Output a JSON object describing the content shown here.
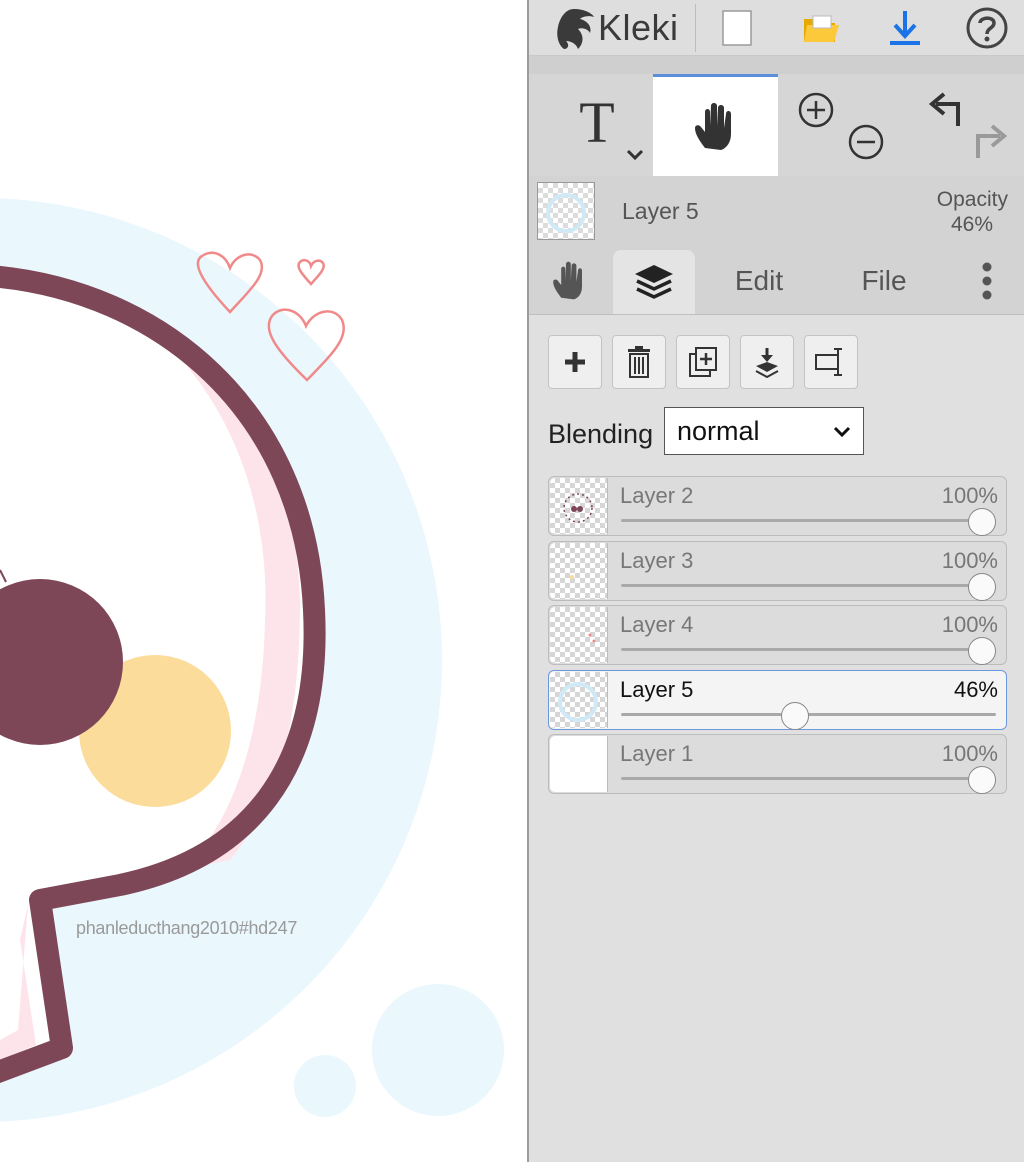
{
  "app": {
    "name": "Kleki"
  },
  "canvas": {
    "signature": "phanleducthang2010#hd247",
    "colors": {
      "outline": "#7d4757",
      "light_blue": "#eaf7fd",
      "pink_shadow": "#fde4ea",
      "dark_circle": "#7d4757",
      "yellow_circle": "#fcdc9a",
      "hearts": "#f08a8a"
    }
  },
  "toolbar": {
    "icons": [
      "kleki-logo-icon",
      "new-file-icon",
      "open-folder-icon",
      "download-icon",
      "help-icon"
    ]
  },
  "tools": {
    "text_glyph": "T",
    "active_tool": "hand"
  },
  "current_layer": {
    "name": "Layer 5",
    "opacity_label": "Opacity",
    "opacity_value": "46%"
  },
  "tabs": {
    "edit_label": "Edit",
    "file_label": "File",
    "active": "layers"
  },
  "layers_panel": {
    "blending_label": "Blending",
    "blending_value": "normal",
    "layers": [
      {
        "name": "Layer 2",
        "opacity": "100%",
        "opacity_fraction": 1.0,
        "active": false
      },
      {
        "name": "Layer 3",
        "opacity": "100%",
        "opacity_fraction": 1.0,
        "active": false
      },
      {
        "name": "Layer 4",
        "opacity": "100%",
        "opacity_fraction": 1.0,
        "active": false
      },
      {
        "name": "Layer 5",
        "opacity": "46%",
        "opacity_fraction": 0.46,
        "active": true
      },
      {
        "name": "Layer 1",
        "opacity": "100%",
        "opacity_fraction": 1.0,
        "active": false
      }
    ]
  },
  "accent_color": "#5c8fd9"
}
